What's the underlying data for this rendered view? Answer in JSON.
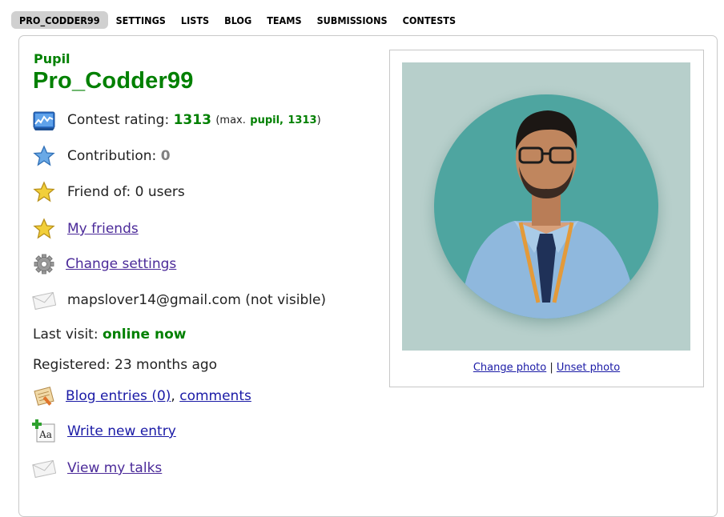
{
  "nav": {
    "tabs": [
      "PRO_CODDER99",
      "SETTINGS",
      "LISTS",
      "BLOG",
      "TEAMS",
      "SUBMISSIONS",
      "CONTESTS"
    ],
    "active": "PRO_CODDER99"
  },
  "profile": {
    "rank": "Pupil",
    "handle": "Pro_Codder99",
    "rating_label": "Contest rating:",
    "rating": "1313",
    "max_prefix": "(max.",
    "max_rank": "pupil,",
    "max_rating": "1313",
    "max_suffix": ")",
    "contribution_label": "Contribution:",
    "contribution": "0",
    "friend_of": "Friend of: 0 users",
    "my_friends": "My friends",
    "change_settings": "Change settings",
    "email": "mapslover14@gmail.com (not visible)",
    "last_visit_label": "Last visit:",
    "last_visit": "online now",
    "registered": "Registered: 23 months ago",
    "blog_entries": "Blog entries (0)",
    "comma": ",",
    "comments": "comments",
    "write_new_entry": "Write new entry",
    "view_my_talks": "View my talks"
  },
  "photo": {
    "change": "Change photo",
    "separator": "|",
    "unset": "Unset photo"
  },
  "colors": {
    "rank_green": "#008000",
    "link_purple": "#4b2a99",
    "link_blue": "#1a1aa6",
    "photo_bg": "#b7cfcb"
  },
  "icons": [
    "rating-chart-icon",
    "contribution-star-icon",
    "friend-of-star-icon",
    "my-friends-star-icon",
    "settings-gear-icon",
    "email-envelope-icon",
    "blog-icon",
    "write-entry-icon",
    "talks-envelope-icon"
  ]
}
